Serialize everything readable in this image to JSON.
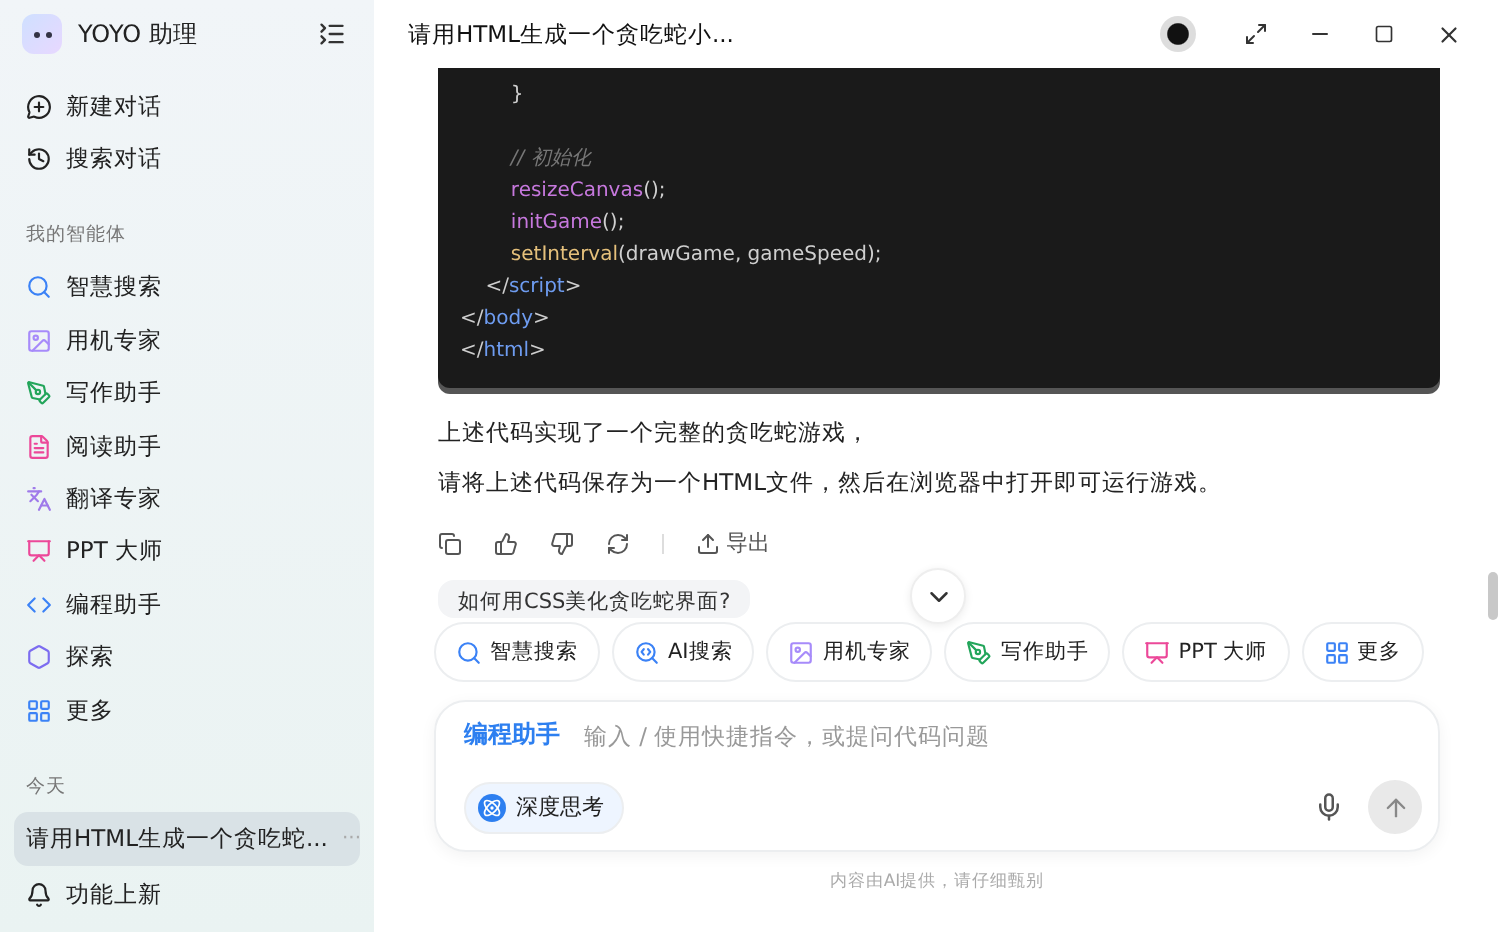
{
  "app": {
    "name": "YOYO 助理"
  },
  "sidebar": {
    "actions": [
      {
        "label": "新建对话"
      },
      {
        "label": "搜索对话"
      }
    ],
    "agents_heading": "我的智能体",
    "agents": [
      {
        "label": "智慧搜索",
        "color": "#3b82f6"
      },
      {
        "label": "用机专家",
        "color": "#a78bfa"
      },
      {
        "label": "写作助手",
        "color": "#22a55a"
      },
      {
        "label": "阅读助手",
        "color": "#ec4899"
      },
      {
        "label": "翻译专家",
        "color": "#9f7aea"
      },
      {
        "label": "PPT 大师",
        "color": "#ec4899"
      },
      {
        "label": "编程助手",
        "color": "#3b82f6"
      },
      {
        "label": "探索",
        "color": "#7c6cf0"
      },
      {
        "label": "更多",
        "color": "#3b82f6"
      }
    ],
    "history_heading": "今天",
    "history": [
      {
        "title": "请用HTML生成一个贪吃蛇...",
        "selected": true,
        "more": "···"
      }
    ],
    "footer": {
      "label": "功能上新"
    }
  },
  "chat": {
    "title": "请用HTML生成一个贪吃蛇小...",
    "code_lines": [
      {
        "kind": "code",
        "parts": [
          {
            "kind": "punct",
            "text": "        }"
          }
        ]
      },
      {
        "kind": "blank"
      },
      {
        "kind": "code",
        "parts": [
          {
            "kind": "comment",
            "text": "        // 初始化"
          }
        ]
      },
      {
        "kind": "code",
        "parts": [
          {
            "kind": "func",
            "text": "        resizeCanvas"
          },
          {
            "kind": "punct",
            "text": "();"
          }
        ]
      },
      {
        "kind": "code",
        "parts": [
          {
            "kind": "func",
            "text": "        initGame"
          },
          {
            "kind": "punct",
            "text": "();"
          }
        ]
      },
      {
        "kind": "code",
        "parts": [
          {
            "kind": "builtin",
            "text": "        setInterval"
          },
          {
            "kind": "punct",
            "text": "(drawGame, gameSpeed);"
          }
        ]
      },
      {
        "kind": "code",
        "parts": [
          {
            "kind": "punct",
            "text": "    </"
          },
          {
            "kind": "tag",
            "text": "script"
          },
          {
            "kind": "punct",
            "text": ">"
          }
        ]
      },
      {
        "kind": "code",
        "parts": [
          {
            "kind": "punct",
            "text": "</"
          },
          {
            "kind": "tag",
            "text": "body"
          },
          {
            "kind": "punct",
            "text": ">"
          }
        ]
      },
      {
        "kind": "code",
        "parts": [
          {
            "kind": "punct",
            "text": "</"
          },
          {
            "kind": "tag",
            "text": "html"
          },
          {
            "kind": "punct",
            "text": ">"
          }
        ]
      }
    ],
    "paragraphs": [
      "上述代码实现了一个完整的贪吃蛇游戏，",
      "请将上述代码保存为一个HTML文件，然后在浏览器中打开即可运行游戏。"
    ],
    "export_label": "导出",
    "suggestion": "如何用CSS美化贪吃蛇界面?"
  },
  "quick_chips": [
    {
      "label": "智慧搜索",
      "color": "#3b82f6"
    },
    {
      "label": "AI搜索",
      "color": "#3b82f6"
    },
    {
      "label": "用机专家",
      "color": "#a78bfa"
    },
    {
      "label": "写作助手",
      "color": "#22a55a"
    },
    {
      "label": "PPT 大师",
      "color": "#ec4899"
    },
    {
      "label": "更多",
      "color": "#3b82f6"
    }
  ],
  "composer": {
    "agent": "编程助手",
    "placeholder": "输入 / 使用快捷指令，或提问代码问题",
    "deep_think": {
      "label": "深度思考",
      "on": true
    }
  },
  "disclaimer": "内容由AI提供，请仔细甄别"
}
